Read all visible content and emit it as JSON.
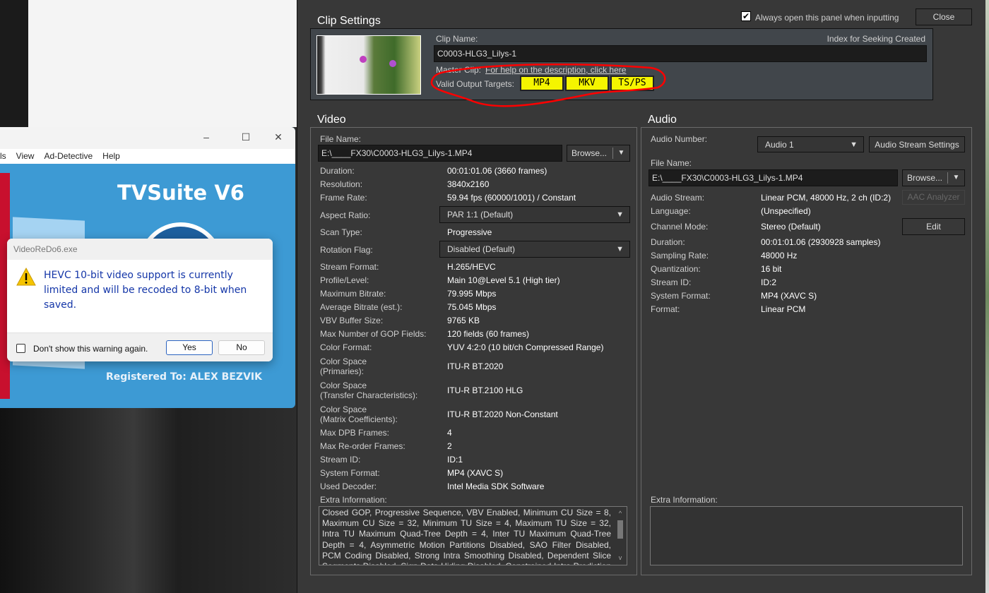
{
  "background_app": {
    "menu": [
      "ls",
      "View",
      "Ad-Detective",
      "Help"
    ],
    "brand": "TVSuite V6",
    "registered": "Registered To: ALEX BEZVIK"
  },
  "dialog": {
    "title": "VideoReDo6.exe",
    "message": "HEVC 10-bit video support is currently limited and will be recoded to 8-bit when saved.",
    "checkbox_label": "Don't show this warning again.",
    "yes": "Yes",
    "no": "No"
  },
  "panel": {
    "title": "Clip Settings",
    "always_open_label": "Always open this panel when inputting",
    "always_open_checked": true,
    "close": "Close",
    "clip": {
      "clip_name_label": "Clip Name:",
      "index_status": "Index for Seeking Created",
      "clip_name": "C0003-HLG3_Lilys-1",
      "master_clip_label": "Master Clip:",
      "help_link": "For help on the description, click here",
      "targets_label": "Valid Output Targets:",
      "targets": [
        "MP4",
        "MKV",
        "TS/PS"
      ],
      "highlight_color": "#ff0000",
      "target_color": "#f5f500"
    },
    "video": {
      "heading": "Video",
      "file_label": "File Name:",
      "file": "E:\\____FX30\\C0003-HLG3_Lilys-1.MP4",
      "browse": "Browse...",
      "rows": [
        [
          "Duration:",
          "00:01:01.06 (3660 frames)"
        ],
        [
          "Resolution:",
          "3840x2160"
        ],
        [
          "Frame Rate:",
          "59.94 fps (60000/1001) / Constant"
        ],
        [
          "Aspect Ratio:",
          "PAR 1:1 (Default)"
        ],
        [
          "Scan Type:",
          "Progressive"
        ],
        [
          "Rotation Flag:",
          "Disabled (Default)"
        ],
        [
          "Stream Format:",
          "H.265/HEVC"
        ],
        [
          "Profile/Level:",
          "Main 10@Level 5.1 (High tier)"
        ],
        [
          "Maximum Bitrate:",
          "79.995 Mbps"
        ],
        [
          "Average Bitrate (est.):",
          "75.045 Mbps"
        ],
        [
          "VBV Buffer Size:",
          "9765  KB"
        ],
        [
          "Max Number of GOP Fields:",
          "120 fields (60 frames)"
        ],
        [
          "Color Format:",
          "YUV 4:2:0 (10 bit/ch Compressed Range)"
        ],
        [
          "Color Space\n(Primaries):",
          "ITU-R BT.2020"
        ],
        [
          "Color Space\n(Transfer Characteristics):",
          "ITU-R BT.2100 HLG"
        ],
        [
          "Color Space\n(Matrix Coefficients):",
          "ITU-R BT.2020 Non-Constant"
        ],
        [
          "Max DPB Frames:",
          "4"
        ],
        [
          "Max Re-order Frames:",
          "2"
        ],
        [
          "Stream ID:",
          "ID:1"
        ],
        [
          "System Format:",
          "MP4 (XAVC S)"
        ],
        [
          "Used Decoder:",
          "Intel Media SDK Software"
        ]
      ],
      "extra_label": "Extra Information:",
      "extra": "Closed GOP, Progressive Sequence, VBV Enabled, Minimum CU Size = 8, Maximum CU Size = 32, Minimum TU Size = 4, Maximum TU Size = 32, Intra TU Maximum Quad-Tree Depth = 4, Inter TU Maximum Quad-Tree Depth = 4, Asymmetric Motion Partitions Disabled, SAO Filter Disabled, PCM Coding Disabled, Strong Intra Smoothing Disabled, Dependent Slice Segments Disabled, Sign Data Hiding Disabled, Constrained Intra Prediction Disabled,"
    },
    "audio": {
      "heading": "Audio",
      "number_label": "Audio Number:",
      "number": "Audio 1",
      "stream_settings": "Audio Stream Settings",
      "file_label": "File Name:",
      "file": "E:\\____FX30\\C0003-HLG3_Lilys-1.MP4",
      "browse": "Browse...",
      "aac": "AAC Analyzer",
      "edit": "Edit",
      "rows": [
        [
          "Audio Stream:",
          "Linear PCM, 48000 Hz, 2 ch (ID:2)"
        ],
        [
          "Language:",
          "(Unspecified)"
        ],
        [
          "Channel Mode:",
          "Stereo (Default)"
        ],
        [
          "Duration:",
          "00:01:01.06 (2930928 samples)"
        ],
        [
          "Sampling Rate:",
          "48000 Hz"
        ],
        [
          "Quantization:",
          "16 bit"
        ],
        [
          "Stream ID:",
          "ID:2"
        ],
        [
          "System Format:",
          "MP4 (XAVC S)"
        ],
        [
          "Format:",
          "Linear PCM"
        ]
      ],
      "extra_label": "Extra Information:",
      "extra": ""
    }
  }
}
